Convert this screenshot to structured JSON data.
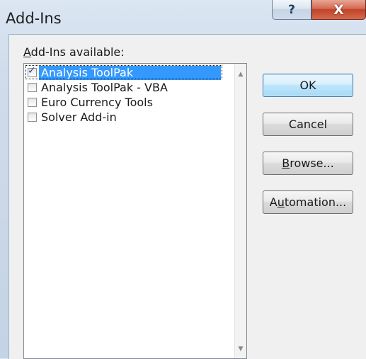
{
  "window": {
    "title": "Add-Ins",
    "help_glyph": "?",
    "close_glyph": "X"
  },
  "list": {
    "label_accel": "A",
    "label_rest": "dd-Ins available:",
    "items": [
      {
        "label": "Analysis ToolPak",
        "checked": true,
        "selected": true
      },
      {
        "label": "Analysis ToolPak - VBA",
        "checked": false,
        "selected": false
      },
      {
        "label": "Euro Currency Tools",
        "checked": false,
        "selected": false
      },
      {
        "label": "Solver Add-in",
        "checked": false,
        "selected": false
      }
    ],
    "scroll_up": "▲",
    "scroll_down": "▼"
  },
  "buttons": {
    "ok": "OK",
    "cancel": "Cancel",
    "browse_accel": "B",
    "browse_rest": "rowse...",
    "automation_pre": "A",
    "automation_accel": "u",
    "automation_rest": "tomation..."
  },
  "icons": {
    "checkmark": "✓"
  }
}
